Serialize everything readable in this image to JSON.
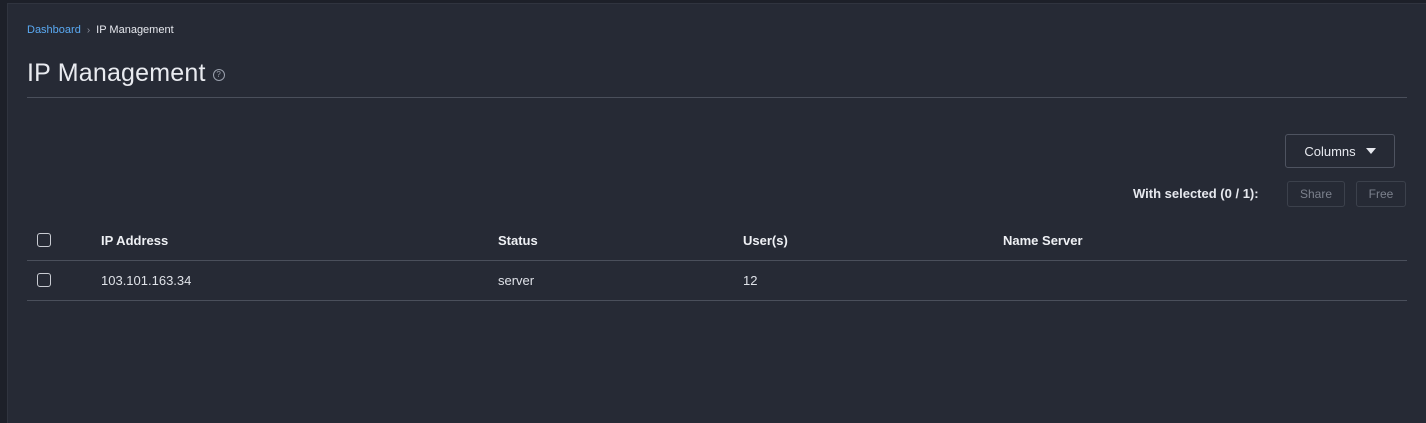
{
  "breadcrumb": {
    "root": "Dashboard",
    "separator": "›",
    "current": "IP Management"
  },
  "page": {
    "title": "IP Management",
    "help_icon": "?"
  },
  "toolbar": {
    "columns_label": "Columns",
    "bulk_label": "With selected (0 / 1):",
    "share_label": "Share",
    "free_label": "Free"
  },
  "table": {
    "headers": {
      "ip": "IP Address",
      "status": "Status",
      "users": "User(s)",
      "name_server": "Name Server"
    },
    "rows": [
      {
        "ip": "103.101.163.34",
        "status": "server",
        "users": "12",
        "name_server": ""
      }
    ]
  },
  "colors": {
    "link": "#5aa9f2",
    "background": "#262a35"
  }
}
